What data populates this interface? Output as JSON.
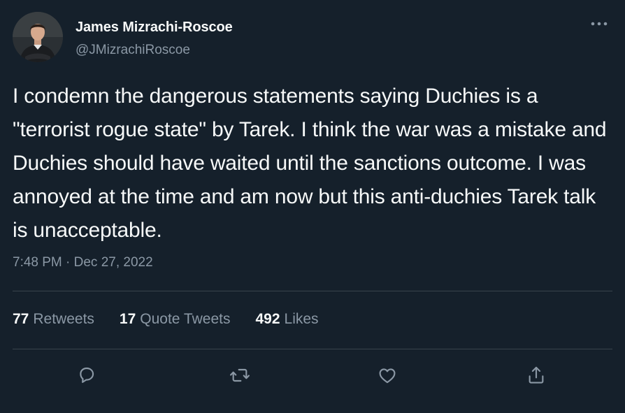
{
  "author": {
    "name": "James Mizrachi-Roscoe",
    "handle": "@JMizrachiRoscoe"
  },
  "tweet": {
    "text": "I condemn the dangerous statements saying Duchies is a \"terrorist rogue state\" by Tarek. I think the war was a mistake and Duchies should have waited until the sanctions outcome. I was annoyed at the time and am now but this anti-duchies Tarek talk is unacceptable.",
    "timestamp": "7:48 PM · Dec 27, 2022"
  },
  "stats": {
    "retweets_count": "77",
    "retweets_label": "Retweets",
    "quotes_count": "17",
    "quotes_label": "Quote Tweets",
    "likes_count": "492",
    "likes_label": "Likes"
  },
  "actions": [
    {
      "icon": "reply-icon"
    },
    {
      "icon": "retweet-icon"
    },
    {
      "icon": "like-icon"
    },
    {
      "icon": "share-icon"
    }
  ],
  "colors": {
    "background": "#15202b",
    "primary_text": "#f7f9f9",
    "secondary_text": "#8b98a5",
    "divider": "#38444d"
  }
}
